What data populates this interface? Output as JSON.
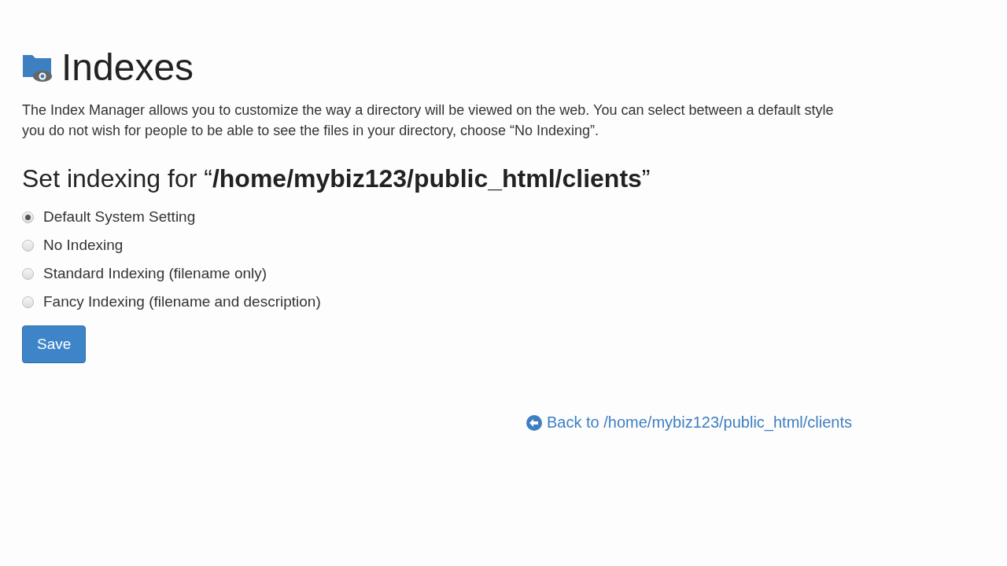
{
  "page": {
    "title": "Indexes",
    "description_lines": [
      "The Index Manager allows you to customize the way a directory will be viewed on the web. You can select between a default style",
      "you do not wish for people to be able to see the files in your directory, choose “No Indexing”."
    ]
  },
  "form": {
    "heading": "Set indexing for “**/home/mybiz123/public_html/clients**”",
    "options": [
      {
        "label": "Default System Setting",
        "selected": true
      },
      {
        "label": "No Indexing",
        "selected": false
      },
      {
        "label": "Standard Indexing (filename only)",
        "selected": false
      },
      {
        "label": "Fancy Indexing (filename and description)",
        "selected": false
      }
    ],
    "save_button": "Save"
  },
  "back_link": "Back to /home/mybiz123/public_html/clients"
}
